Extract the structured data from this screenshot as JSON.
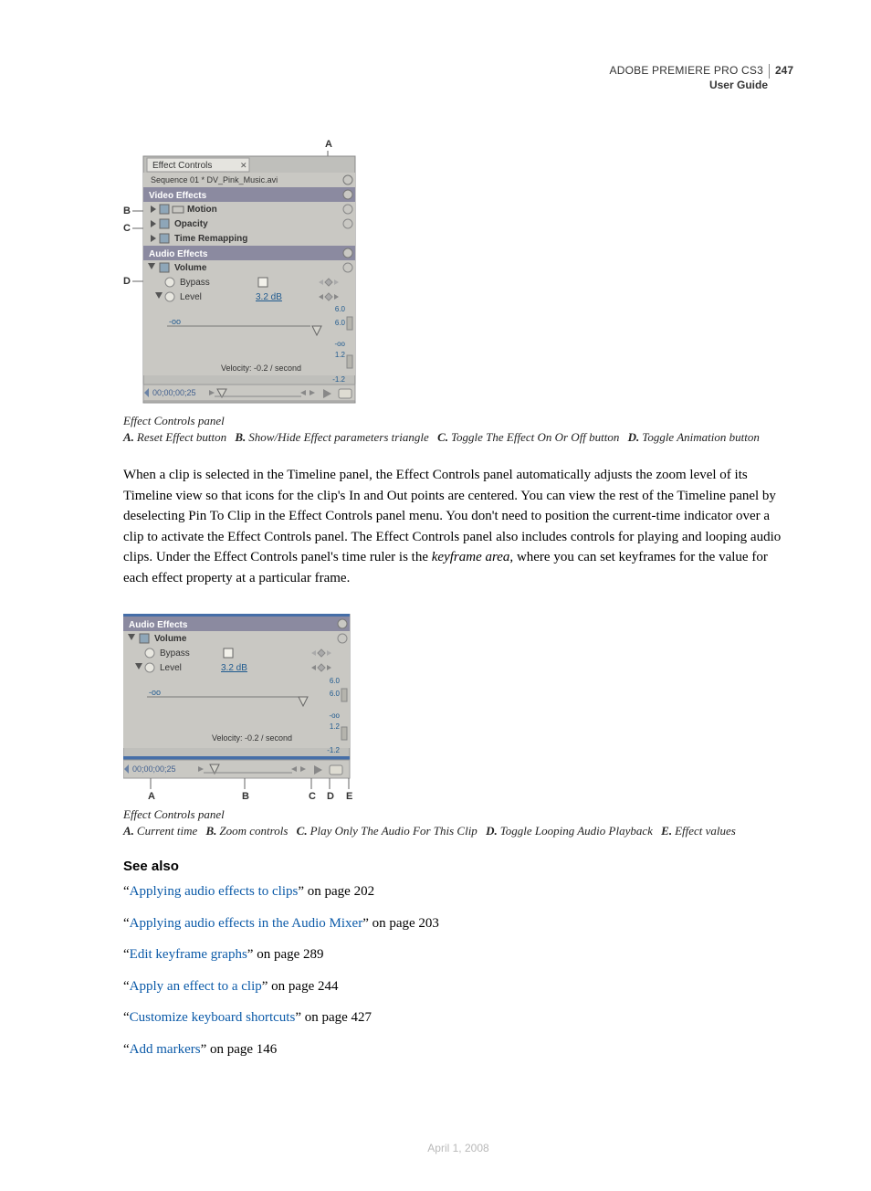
{
  "header": {
    "product": "ADOBE PREMIERE PRO CS3",
    "page_number": "247",
    "subtitle": "User Guide"
  },
  "figure1": {
    "panel_title": "Effect Controls",
    "sequence_line": "Sequence 01 * DV_Pink_Music.avi",
    "section_video": "Video Effects",
    "row_motion": "Motion",
    "row_opacity": "Opacity",
    "row_time": "Time Remapping",
    "section_audio": "Audio Effects",
    "row_volume": "Volume",
    "row_bypass": "Bypass",
    "row_level": "Level",
    "level_value": "3.2 dB",
    "neg_inf": "-oo",
    "y_top": "6.0",
    "y_mid": "6.0",
    "y_neg_inf": "-oo",
    "y_12": "1.2",
    "y_neg12": "-1.2",
    "velocity": "Velocity: -0.2 / second",
    "timecode": "00;00;00;25",
    "markerA": "A",
    "markerB": "B",
    "markerC": "C",
    "markerD": "D"
  },
  "caption1": {
    "title": "Effect Controls panel",
    "A": "Reset Effect button",
    "B": "Show/Hide Effect parameters triangle",
    "C": "Toggle The Effect On Or Off button",
    "D": "Toggle Animation button"
  },
  "paragraph": {
    "pre": "When a clip is selected in the Timeline panel, the Effect Controls panel automatically adjusts the zoom level of its Timeline view so that icons for the clip's In and Out points are centered. You can view the rest of the Timeline panel by deselecting Pin To Clip in the Effect Controls panel menu. You don't need to position the current-time indicator over a clip to activate the Effect Controls panel. The Effect Controls panel also includes controls for playing and looping audio clips. Under the Effect Controls panel's time ruler is the ",
    "em": "keyframe area,",
    "post": " where you can set keyframes for the value for each effect property at a particular frame."
  },
  "figure2": {
    "section_audio": "Audio Effects",
    "row_volume": "Volume",
    "row_bypass": "Bypass",
    "row_level": "Level",
    "level_value": "3.2 dB",
    "neg_inf": "-oo",
    "y_top": "6.0",
    "y_mid": "6.0",
    "y_neg_inf": "-oo",
    "y_12": "1.2",
    "y_neg12": "-1.2",
    "velocity": "Velocity: -0.2 / second",
    "timecode": "00;00;00;25",
    "markerA": "A",
    "markerB": "B",
    "markerC": "C",
    "markerD": "D",
    "markerE": "E"
  },
  "caption2": {
    "title": "Effect Controls panel",
    "A": "Current time",
    "B": "Zoom controls",
    "C": "Play Only The Audio For This Clip",
    "D": "Toggle Looping Audio Playback",
    "E": "Effect values"
  },
  "see_also": {
    "heading": "See also",
    "items": [
      {
        "q1": "“",
        "link": "Applying audio effects to clips",
        "q2": "” on page 202"
      },
      {
        "q1": "“",
        "link": "Applying audio effects in the Audio Mixer",
        "q2": "” on page 203"
      },
      {
        "q1": "“",
        "link": "Edit keyframe graphs",
        "q2": "” on page 289"
      },
      {
        "q1": "“",
        "link": "Apply an effect to a clip",
        "q2": "” on page 244"
      },
      {
        "q1": "“",
        "link": "Customize keyboard shortcuts",
        "q2": "” on page 427"
      },
      {
        "q1": "“",
        "link": "Add markers",
        "q2": "” on page 146"
      }
    ]
  },
  "footer_date": "April 1, 2008"
}
